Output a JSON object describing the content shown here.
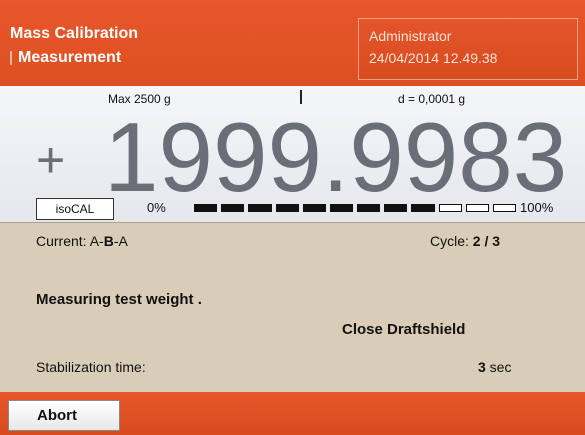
{
  "header": {
    "title": "Mass Calibration",
    "subtitle": "Measurement",
    "user": "Administrator",
    "datetime": "24/04/2014 12.49.38"
  },
  "display": {
    "max_label": "Max 2500 g",
    "d_label": "d = 0,0001 g",
    "sign": "+",
    "weight": "1999.9983",
    "isocal_label": "isoCAL",
    "progress_min_label": "0%",
    "progress_max_label": "100%",
    "progress": {
      "filled_segments": 9,
      "total_segments": 12
    }
  },
  "status": {
    "current_prefix": "Current: A-",
    "current_highlight": "B",
    "current_suffix": "-A",
    "cycle_label": "Cycle: ",
    "cycle_value": "2 / 3",
    "message": "Measuring test weight .",
    "instruction": "Close Draftshield",
    "stabilization_label": "Stabilization time:",
    "stabilization_value": "3",
    "stabilization_unit": " sec"
  },
  "footer": {
    "abort_label": "Abort"
  },
  "colors": {
    "brand_orange": "#e0522a",
    "panel_beige": "#d9cdb8",
    "weight_gray": "#6a6e78"
  }
}
